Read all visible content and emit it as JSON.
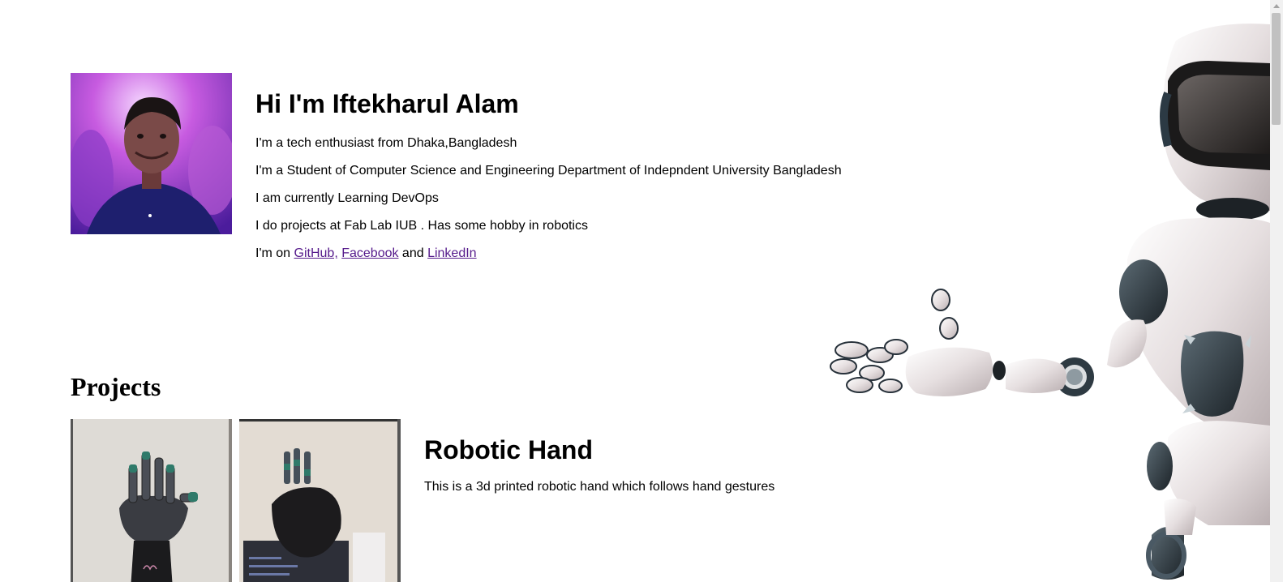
{
  "intro": {
    "heading": "Hi I'm Iftekharul Alam",
    "lines": [
      "I'm a tech enthusiast from Dhaka,Bangladesh",
      "I'm a Student of Computer Science and Engineering Department of Indepndent University Bangladesh",
      "I am currently Learning DevOps",
      "I do projects at Fab Lab IUB . Has some hobby in robotics"
    ],
    "social": {
      "prefix": "I'm on ",
      "github": "GitHub,",
      "sep1": " ",
      "facebook": "Facebook",
      "sep2": " and ",
      "linkedin": "LinkedIn"
    }
  },
  "projects": {
    "heading": "Projects",
    "items": [
      {
        "title": "Robotic Hand",
        "description": "This is a 3d printed robotic hand which follows hand gestures"
      }
    ]
  },
  "colors": {
    "link_visited": "#551a8b",
    "text": "#000000",
    "background": "#ffffff"
  },
  "icons": {
    "robot": "robot-illustration"
  }
}
